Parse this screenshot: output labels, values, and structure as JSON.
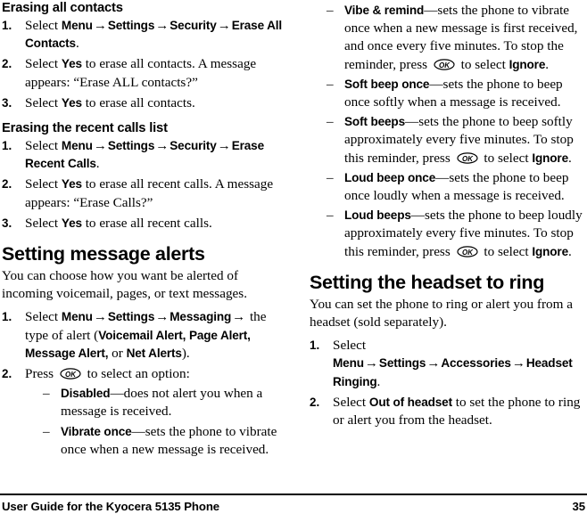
{
  "document": {
    "title": "User Guide for the Kyocera 5135 Phone",
    "page_number": "35",
    "arrow_glyph": "→",
    "dash_glyph": "–",
    "ok_key_label": "OK"
  },
  "left_column": {
    "section_erase_all_contacts": {
      "heading": "Erasing all contacts",
      "steps": [
        {
          "number": "1.",
          "pre": "Select ",
          "ui_1": "Menu",
          "ui_2": "Settings",
          "ui_3": "Security",
          "ui_4": "Erase All Contacts",
          "post": "."
        },
        {
          "number": "2.",
          "pre": "Select ",
          "ui_1": "Yes",
          "post": " to erase all contacts. A message appears: “Erase ALL contacts?”"
        },
        {
          "number": "3.",
          "pre": "Select ",
          "ui_1": "Yes",
          "post": " to erase all contacts."
        }
      ]
    },
    "section_erase_recent_calls": {
      "heading": "Erasing the recent calls list",
      "steps": [
        {
          "number": "1.",
          "pre": "Select ",
          "ui_1": "Menu",
          "ui_2": "Settings",
          "ui_3": "Security",
          "ui_4": "Erase Recent Calls",
          "post": "."
        },
        {
          "number": "2.",
          "pre": "Select ",
          "ui_1": "Yes",
          "post": " to erase all recent calls. A message appears: “Erase Calls?”"
        },
        {
          "number": "3.",
          "pre": "Select ",
          "ui_1": "Yes",
          "post": " to erase all recent calls."
        }
      ]
    },
    "section_message_alerts": {
      "heading": "Setting message alerts",
      "intro": "You can choose how you want be alerted of incoming voicemail, pages, or text messages.",
      "step1": {
        "number": "1.",
        "pre": "Select ",
        "ui_1": "Menu",
        "ui_2": "Settings",
        "ui_3": "Messaging",
        "mid": " the type of alert (",
        "ui_4": "Voicemail Alert, Page Alert, Message Alert,",
        "mid2": " or ",
        "ui_5": "Net Alerts",
        "post": ")."
      },
      "step2": {
        "number": "2.",
        "pre": "Press ",
        "post": " to select an option:"
      },
      "options": [
        {
          "term": "Disabled",
          "desc": "—does not alert you when a message is received."
        },
        {
          "term": "Vibrate once",
          "desc": "—sets the phone to vibrate once when a new message is received."
        }
      ]
    }
  },
  "right_column": {
    "options_continued": [
      {
        "term": "Vibe & remind",
        "desc_1": "—sets the phone to vibrate once when a new message is first received, and once every five minutes. To stop the reminder, press ",
        "desc_2": " to select ",
        "ui_1": "Ignore",
        "desc_3": "."
      },
      {
        "term": "Soft beep once",
        "desc_1": "—sets the phone to beep once softly when a message is received."
      },
      {
        "term": "Soft beeps",
        "desc_1": "—sets the phone to beep softly approximately every five minutes. To stop this reminder, press ",
        "desc_2": " to select ",
        "ui_1": "Ignore",
        "desc_3": "."
      },
      {
        "term": "Loud beep once",
        "desc_1": "—sets the phone to beep once loudly when a message is received."
      },
      {
        "term": "Loud beeps",
        "desc_1": "—sets the phone to beep loudly approximately every five minutes. To stop this reminder, press ",
        "desc_2": " to select ",
        "ui_1": "Ignore",
        "desc_3": "."
      }
    ],
    "section_headset": {
      "heading": "Setting the headset to ring",
      "intro": "You can set the phone to ring or alert you from a headset (sold separately).",
      "steps": [
        {
          "number": "1.",
          "pre": "Select ",
          "ui_1": "Menu",
          "ui_2": "Settings",
          "ui_3": "Accessories",
          "ui_4": "Headset Ringing",
          "post": "."
        },
        {
          "number": "2.",
          "pre": "Select ",
          "ui_1": "Out of headset",
          "post": " to set the phone to ring or alert you from the headset."
        }
      ]
    }
  }
}
